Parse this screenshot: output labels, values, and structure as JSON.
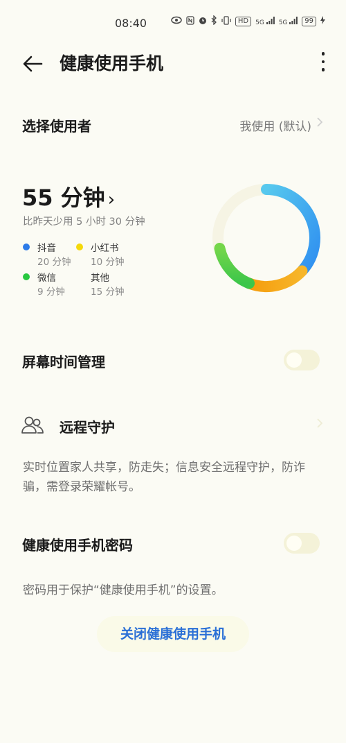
{
  "status_bar": {
    "time": "08:40",
    "icons": [
      "eye-icon",
      "nfc-icon",
      "alarm-icon",
      "bluetooth-icon",
      "vibrate-icon",
      "hd-icon",
      "signal-5g-icon",
      "signal-5g-icon",
      "battery-icon",
      "charging-icon"
    ],
    "hd": "HD",
    "net1": "5G",
    "net2": "5G",
    "battery": "99"
  },
  "header": {
    "title": "健康使用手机"
  },
  "user_row": {
    "label": "选择使用者",
    "value": "我使用 (默认)"
  },
  "usage": {
    "total": "55 分钟",
    "arrow": "›",
    "compare": "比昨天少用 5 小时 30 分钟",
    "apps": [
      {
        "name": "抖音",
        "minutes": "20 分钟",
        "color": "#2d7be8"
      },
      {
        "name": "小红书",
        "minutes": "10 分钟",
        "color": "#f5d90a"
      },
      {
        "name": "微信",
        "minutes": "9 分钟",
        "color": "#28c840"
      },
      {
        "name": "其他",
        "minutes": "15 分钟",
        "color": "#fbfbf4"
      }
    ]
  },
  "screen_time": {
    "label": "屏幕时间管理"
  },
  "remote": {
    "label": "远程守护",
    "description": "实时位置家人共享，防走失；信息安全远程守护，防诈骗，需登录荣耀帐号。"
  },
  "password": {
    "label": "健康使用手机密码",
    "description": "密码用于保护“健康使用手机”的设置。"
  },
  "actions": {
    "close_label": "关闭健康使用手机"
  },
  "colors": {
    "accent": "#2a6fd6",
    "ring_blue": "#3aa7f0",
    "ring_orange": "#f5a80e",
    "ring_green": "#30c84a"
  }
}
